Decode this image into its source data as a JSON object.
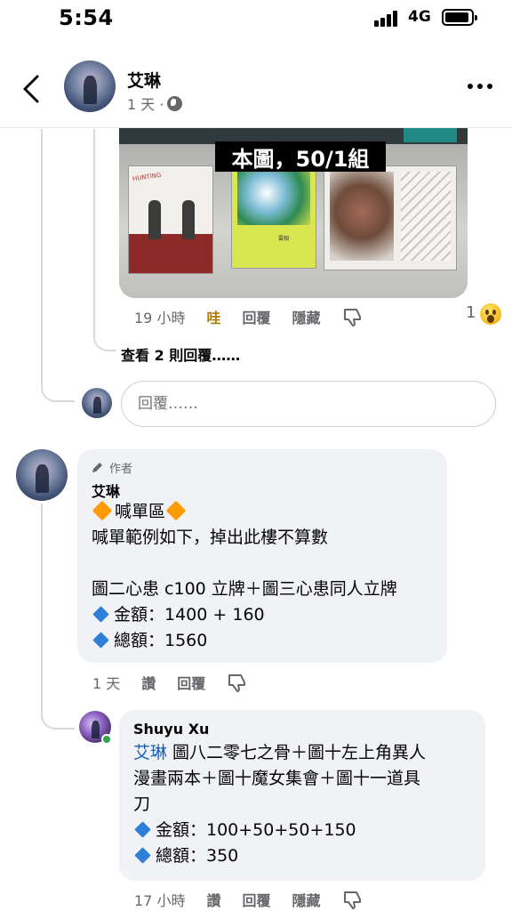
{
  "status_bar": {
    "time": "5:54",
    "network": "4G"
  },
  "header": {
    "name": "艾琳",
    "meta": "1 天 ·"
  },
  "image": {
    "overlay_text": "本圖，50/1組"
  },
  "comment1": {
    "time": "19 小時",
    "reaction": "哇",
    "reply": "回覆",
    "hide": "隱藏",
    "reaction_count": "1",
    "view_replies": "查看 2 則回覆……"
  },
  "reply_box": {
    "placeholder": "回覆……"
  },
  "comment2": {
    "author_tag": "作者",
    "name": "艾琳",
    "title": "喊單區",
    "line1": "喊單範例如下，掉出此樓不算數",
    "line2": "圖二心患 c100 立牌＋圖三心患同人立牌",
    "line3": "金額：1400 + 160",
    "line4": "總額：1560",
    "time": "1 天",
    "like": "讚",
    "reply": "回覆"
  },
  "comment3": {
    "name": "Shuyu Xu",
    "mention": "艾琳",
    "line1": " 圖八二零七之骨＋圖十左上角異人",
    "line2": "漫畫兩本＋圖十魔女集會＋圖十一道具",
    "line3": "刀",
    "line4": "金額：100+50+50+150",
    "line5": "總額：350",
    "time": "17 小時",
    "like": "讚",
    "reply": "回覆",
    "hide": "隱藏"
  }
}
